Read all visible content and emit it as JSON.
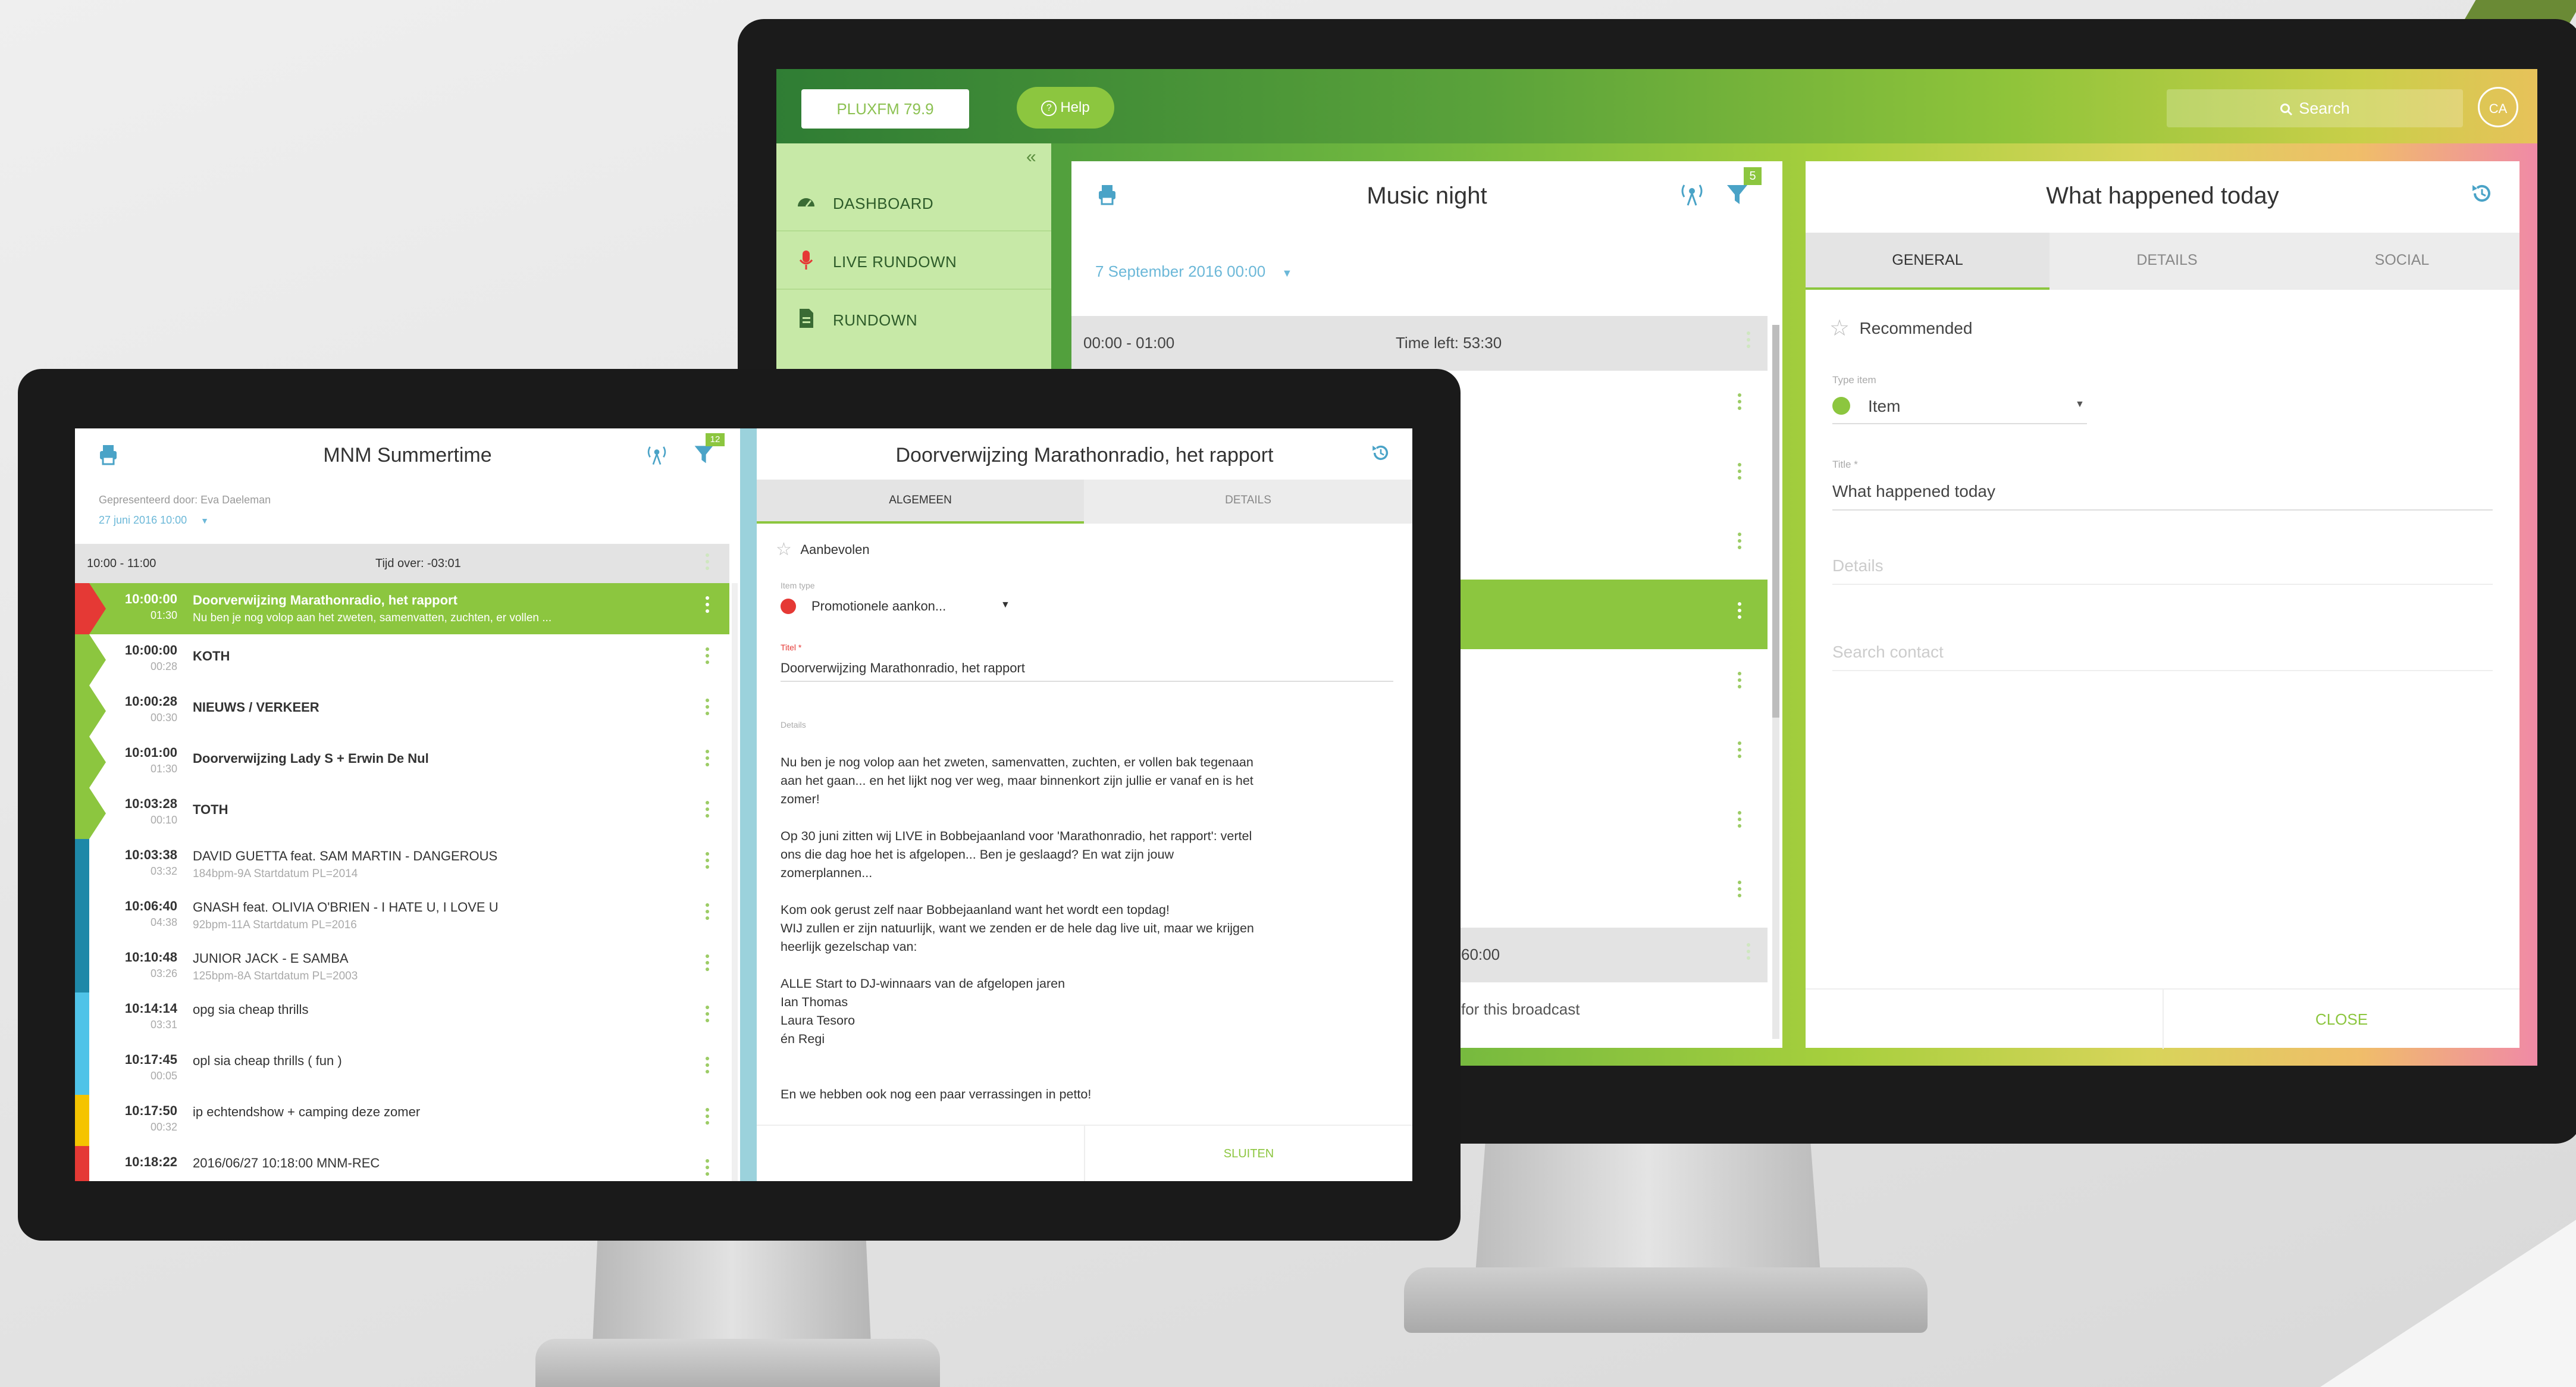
{
  "back": {
    "station_button": "PLUXFM 79.9",
    "help_button": "Help",
    "search": "Search",
    "avatar": "CA",
    "collapse": "«",
    "sidebar": [
      {
        "label": "DASHBOARD",
        "icon": "dashboard-icon"
      },
      {
        "label": "LIVE RUNDOWN",
        "icon": "microphone-icon"
      },
      {
        "label": "RUNDOWN",
        "icon": "document-icon"
      }
    ],
    "rundown": {
      "title": "Music night",
      "date": "7 September 2016 00:00",
      "filter_badge": "5",
      "hour_header": {
        "range": "00:00 - 01:00",
        "time_left": "Time left: 53:30"
      },
      "footer_time": "60:00",
      "footer_note": "for this broadcast"
    },
    "detail": {
      "title": "What happened today",
      "tabs": [
        "GENERAL",
        "DETAILS",
        "SOCIAL"
      ],
      "recommended": "Recommended",
      "type_label": "Type item",
      "type_value": "Item",
      "title_label": "Title *",
      "title_value": "What happened today",
      "details_placeholder": "Details",
      "search_contact_placeholder": "Search contact",
      "close": "CLOSE"
    }
  },
  "front": {
    "program": {
      "title": "MNM Summertime",
      "presented_by": "Gepresenteerd door: Eva Daeleman",
      "date": "27 juni 2016 10:00",
      "filter_badge": "12",
      "hour_header": {
        "range": "10:00 - 11:00",
        "time_left": "Tijd over: -03:01"
      }
    },
    "rows": [
      {
        "time": "10:00:00",
        "duration": "01:30",
        "title": "Doorverwijzing Marathonradio, het rapport",
        "sub": "Nu ben je nog volop aan het zweten, samenvatten, zuchten, er vollen ...",
        "color": "#e53935",
        "active": true,
        "bold": true
      },
      {
        "time": "10:00:00",
        "duration": "00:28",
        "title": "KOTH",
        "sub": "",
        "color": "#8cc63f",
        "active": false,
        "bold": true
      },
      {
        "time": "10:00:28",
        "duration": "00:30",
        "title": "NIEUWS / VERKEER",
        "sub": "",
        "color": "#8cc63f",
        "active": false,
        "bold": true
      },
      {
        "time": "10:01:00",
        "duration": "01:30",
        "title": "Doorverwijzing Lady S + Erwin De Nul",
        "sub": "",
        "color": "#8cc63f",
        "active": false,
        "bold": true
      },
      {
        "time": "10:03:28",
        "duration": "00:10",
        "title": "TOTH",
        "sub": "",
        "color": "#8cc63f",
        "active": false,
        "bold": true
      },
      {
        "time": "10:03:38",
        "duration": "03:32",
        "title": "DAVID GUETTA feat. SAM MARTIN - DANGEROUS",
        "sub": "184bpm-9A Startdatum PL=2014",
        "color": "#1e88a8",
        "active": false,
        "bold": false
      },
      {
        "time": "10:06:40",
        "duration": "04:38",
        "title": "GNASH feat. OLIVIA O'BRIEN - I HATE U, I LOVE U",
        "sub": "92bpm-11A Startdatum PL=2016",
        "color": "#1e88a8",
        "active": false,
        "bold": false
      },
      {
        "time": "10:10:48",
        "duration": "03:26",
        "title": "JUNIOR JACK - E SAMBA",
        "sub": "125bpm-8A Startdatum PL=2003",
        "color": "#1e88a8",
        "active": false,
        "bold": false
      },
      {
        "time": "10:14:14",
        "duration": "03:31",
        "title": "opg sia cheap thrills",
        "sub": "",
        "color": "#4fc3e8",
        "active": false,
        "bold": false
      },
      {
        "time": "10:17:45",
        "duration": "00:05",
        "title": "opl sia cheap thrills ( fun )",
        "sub": "",
        "color": "#4fc3e8",
        "active": false,
        "bold": false
      },
      {
        "time": "10:17:50",
        "duration": "00:32",
        "title": "ip echtendshow + camping deze zomer",
        "sub": "",
        "color": "#f5c400",
        "active": false,
        "bold": false
      },
      {
        "time": "10:18:22",
        "duration": "",
        "title": "2016/06/27 10:18:00 MNM-REC",
        "sub": "",
        "color": "#e53935",
        "active": false,
        "bold": false
      }
    ],
    "detail": {
      "title": "Doorverwijzing Marathonradio, het rapport",
      "tabs": [
        "ALGEMEEN",
        "DETAILS"
      ],
      "recommended": "Aanbevolen",
      "type_label": "Item type",
      "type_value": "Promotionele aankon...",
      "title_label": "Titel *",
      "title_value": "Doorverwijzing Marathonradio, het rapport",
      "details_label": "Details",
      "body": [
        "Nu ben je nog volop aan het zweten, samenvatten, zuchten, er vollen bak tegenaan",
        "aan het gaan... en het lijkt nog ver weg, maar binnenkort zijn jullie er vanaf en is het",
        "zomer!",
        "",
        "Op 30 juni zitten wij LIVE in Bobbejaanland voor 'Marathonradio, het rapport': vertel",
        "ons die dag hoe het is afgelopen... Ben je geslaagd? En wat zijn jouw",
        "zomerplannen...",
        "",
        "Kom ook gerust zelf naar Bobbejaanland want het wordt een topdag!",
        "WIJ zullen er zijn natuurlijk, want we zenden er de hele dag live uit, maar we krijgen",
        "heerlijk gezelschap van:",
        "",
        "ALLE Start to DJ-winnaars van de afgelopen jaren",
        "Ian Thomas",
        "Laura Tesoro",
        "én Regi",
        "",
        "",
        "En we hebben ook nog een paar verrassingen in petto!"
      ],
      "close": "SLUITEN"
    }
  }
}
